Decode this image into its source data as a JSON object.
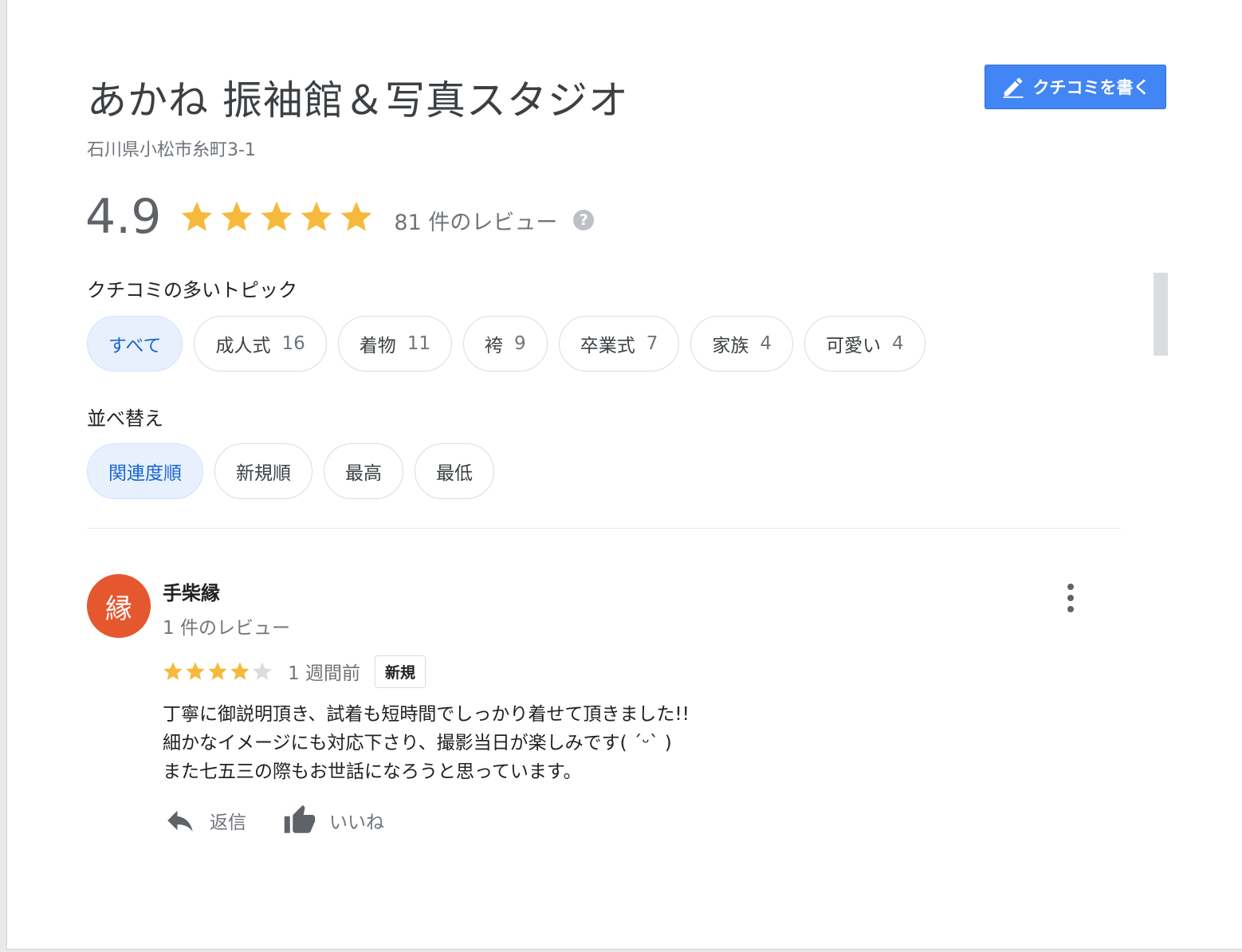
{
  "business": {
    "name": "あかね 振袖館＆写真スタジオ",
    "address": "石川県小松市糸町3-1"
  },
  "write_review": {
    "label": "クチコミを書く",
    "icon": "pencil-icon"
  },
  "rating": {
    "score": "4.9",
    "stars": 5,
    "review_count_text": "81 件のレビュー",
    "help": "?",
    "star_color": "#f6b93b"
  },
  "topics": {
    "heading": "クチコミの多いトピック",
    "chips": [
      {
        "label": "すべて",
        "count": ""
      },
      {
        "label": "成人式",
        "count": "16"
      },
      {
        "label": "着物",
        "count": "11"
      },
      {
        "label": "袴",
        "count": "9"
      },
      {
        "label": "卒業式",
        "count": "7"
      },
      {
        "label": "家族",
        "count": "4"
      },
      {
        "label": "可愛い",
        "count": "4"
      }
    ]
  },
  "sort": {
    "heading": "並べ替え",
    "options": [
      {
        "label": "関連度順"
      },
      {
        "label": "新規順"
      },
      {
        "label": "最高"
      },
      {
        "label": "最低"
      }
    ]
  },
  "review": {
    "avatar_char": "縁",
    "avatar_color": "#e5572e",
    "author": "手柴縁",
    "author_reviews": "1 件のレビュー",
    "stars": 4,
    "date": "1 週間前",
    "badge": "新規",
    "text_lines": [
      "丁寧に御説明頂き、試着も短時間でしっかり着せて頂きました!!",
      "細かなイメージにも対応下さり、撮影当日が楽しみです( ˊᵕˋ )",
      "また七五三の際もお世話になろうと思っています。"
    ],
    "actions": {
      "reply": {
        "label": "返信",
        "icon": "reply-icon"
      },
      "like": {
        "label": "いいね",
        "icon": "thumbs-up-icon"
      }
    }
  }
}
